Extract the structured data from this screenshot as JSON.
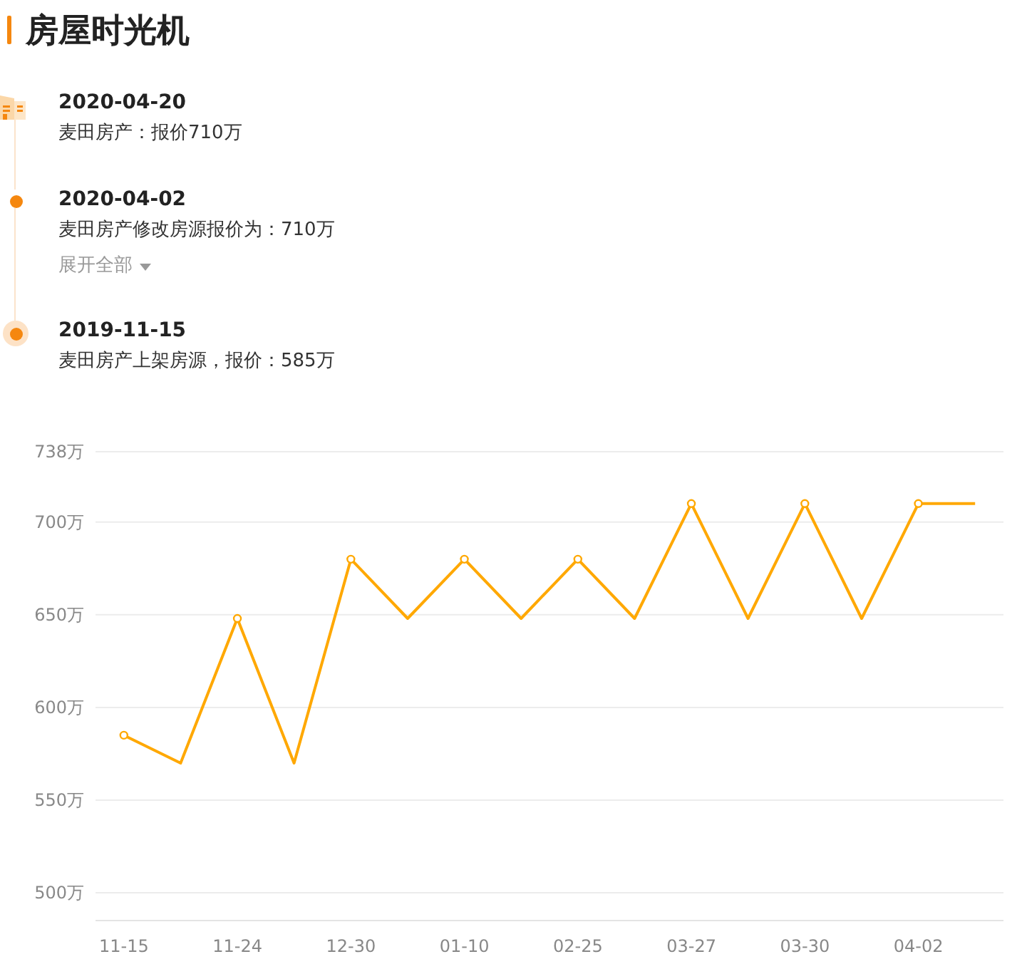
{
  "title": "房屋时光机",
  "timeline": [
    {
      "kind": "building",
      "date": "2020-04-20",
      "text": "麦田房产：报价710万"
    },
    {
      "kind": "dot",
      "date": "2020-04-02",
      "text": "麦田房产修改房源报价为：710万",
      "expand_link": "展开全部"
    },
    {
      "kind": "ring",
      "date": "2019-11-15",
      "text": "麦田房产上架房源，报价：585万"
    }
  ],
  "chart_data": {
    "type": "line",
    "categories": [
      "11-15",
      null,
      "11-24",
      null,
      "12-30",
      null,
      "01-10",
      null,
      "02-25",
      null,
      "03-27",
      null,
      "03-30",
      null,
      "04-02",
      null
    ],
    "series": [
      {
        "color": "#ffa800",
        "values": [
          585,
          570,
          648,
          570,
          680,
          648,
          680,
          648,
          680,
          648,
          710,
          648,
          710,
          648,
          710,
          710
        ]
      }
    ],
    "ylim": [
      485,
      738
    ],
    "grid": true,
    "yticks": [
      {
        "value": 500,
        "label": "500万"
      },
      {
        "value": 550,
        "label": "550万"
      },
      {
        "value": 600,
        "label": "600万"
      },
      {
        "value": 650,
        "label": "650万"
      },
      {
        "value": 700,
        "label": "700万"
      },
      {
        "value": 738,
        "label": "738万"
      }
    ]
  }
}
